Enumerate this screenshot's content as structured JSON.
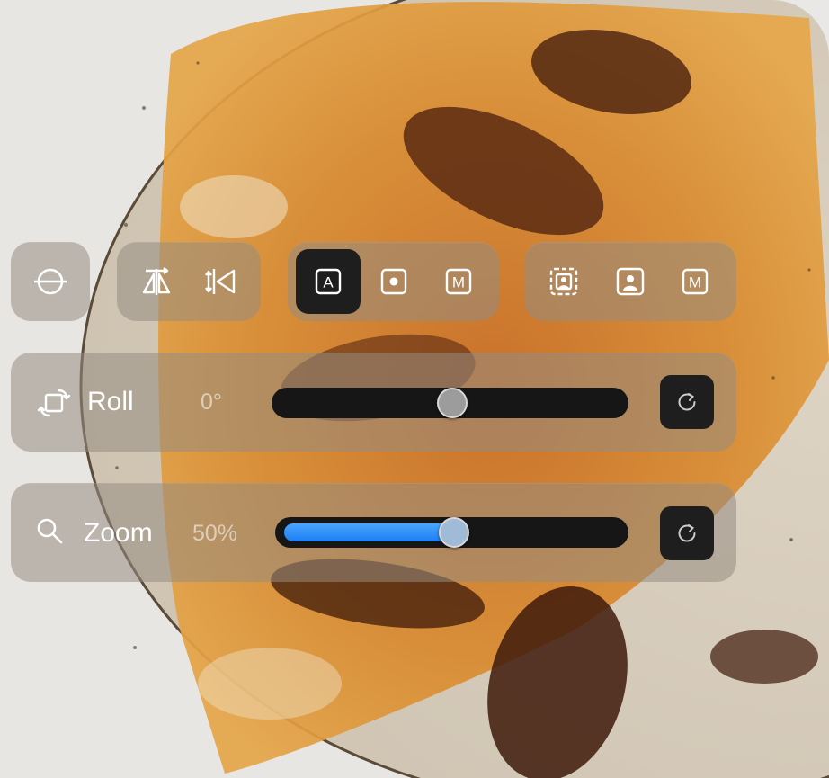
{
  "toolbar": {
    "groups": [
      {
        "name": "level",
        "items": [
          {
            "icon": "horizon-level-icon"
          }
        ]
      },
      {
        "name": "flip",
        "items": [
          {
            "icon": "flip-horizontal-icon"
          },
          {
            "icon": "flip-vertical-icon"
          }
        ]
      },
      {
        "name": "mode",
        "items": [
          {
            "icon": "auto-mode-icon",
            "label": "A",
            "selected": true
          },
          {
            "icon": "center-mode-icon"
          },
          {
            "icon": "manual-mode-icon",
            "label": "M"
          }
        ]
      },
      {
        "name": "framing",
        "items": [
          {
            "icon": "auto-frame-person-icon"
          },
          {
            "icon": "frame-person-icon"
          },
          {
            "icon": "manual-frame-icon",
            "label": "M"
          }
        ]
      }
    ]
  },
  "roll": {
    "label": "Roll",
    "value": "0°",
    "fraction": 0.5,
    "reset_icon": "reset-icon"
  },
  "zoom": {
    "label": "Zoom",
    "value": "50%",
    "fraction": 0.5,
    "reset_icon": "reset-icon"
  },
  "colors": {
    "accent": "#1d7ef2",
    "panel": "rgba(150,140,130,0.55)",
    "control": "#1e1e1e"
  }
}
